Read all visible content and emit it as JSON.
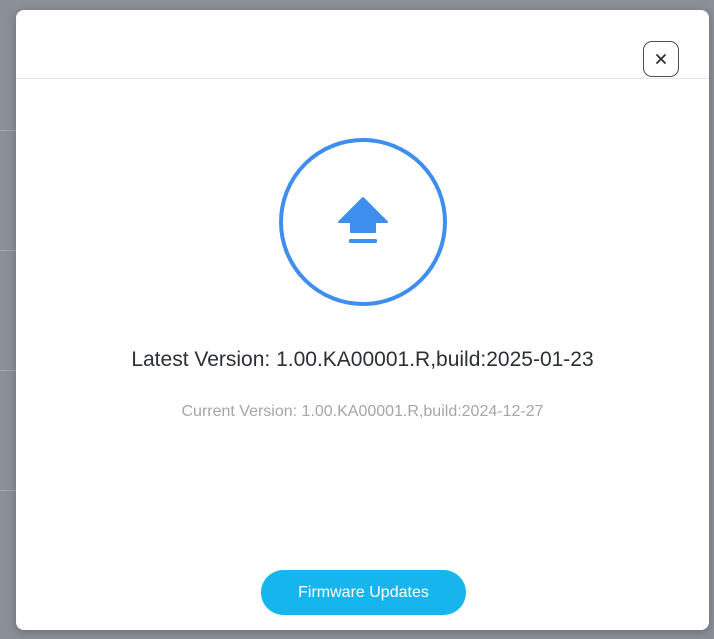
{
  "dialog": {
    "close_icon": "close-icon",
    "upload_icon": "upload-arrow-icon",
    "accent_color": "#3e8eee",
    "button_color": "#17b5ee",
    "latest_version": "Latest Version: 1.00.KA00001.R,build:2025-01-23",
    "current_version": "Current Version: 1.00.KA00001.R,build:2024-12-27",
    "update_button_label": "Firmware Updates"
  }
}
